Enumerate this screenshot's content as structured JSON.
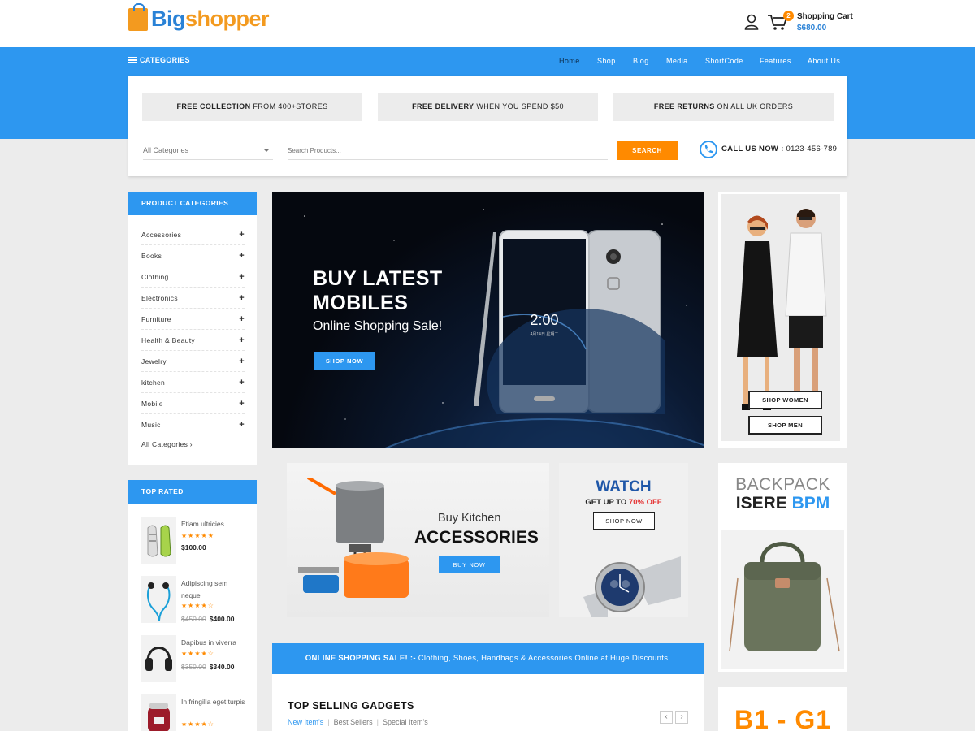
{
  "header": {
    "logo_part1": "Big",
    "logo_part2": "shopper",
    "cart_label": "Shopping Cart",
    "cart_total": "$680.00",
    "cart_count": "2"
  },
  "nav": {
    "categories_label": "CATEGORIES",
    "links": [
      "Home",
      "Shop",
      "Blog",
      "Media",
      "ShortCode",
      "Features",
      "About Us"
    ],
    "active": "Home"
  },
  "promos": [
    {
      "bold": "FREE COLLECTION",
      "rest": " FROM 400+STORES"
    },
    {
      "bold": "FREE DELIVERY",
      "rest": " WHEN YOU SPEND $50"
    },
    {
      "bold": "FREE RETURNS",
      "rest": " ON ALL UK ORDERS"
    }
  ],
  "search": {
    "category_value": "All Categories",
    "placeholder": "Search Products...",
    "button": "SEARCH",
    "call_label": "CALL US NOW :",
    "call_number": " 0123-456-789"
  },
  "product_categories": {
    "title": "PRODUCT CATEGORIES",
    "items": [
      "Accessories",
      "Books",
      "Clothing",
      "Electronics",
      "Furniture",
      "Health & Beauty",
      "Jewelry",
      "kitchen",
      "Mobile",
      "Music"
    ],
    "all_label": "All Categories ›"
  },
  "top_rated": {
    "title": "TOP RATED",
    "items": [
      {
        "name": "Etiam ultricies",
        "stars": "★★★★★",
        "old_price": "",
        "price": "$100.00"
      },
      {
        "name": "Adipiscing sem neque",
        "stars": "★★★★☆",
        "old_price": "$450.00",
        "price": "$400.00"
      },
      {
        "name": "Dapibus in viverra",
        "stars": "★★★★☆",
        "old_price": "$350.00",
        "price": "$340.00"
      },
      {
        "name": "In fringilla eget turpis",
        "stars": "★★★★☆",
        "old_price": "",
        "price": ""
      }
    ]
  },
  "hero": {
    "title_line1": "BUY LATEST",
    "title_line2": "MOBILES",
    "subtitle": "Online Shopping Sale!",
    "button": "SHOP NOW",
    "phone_time": "2:00",
    "phone_date": "4月14日 星期二"
  },
  "fashion": {
    "btn_women": "SHOP WOMEN",
    "btn_men": "SHOP MEN"
  },
  "kitchen": {
    "subtitle": "Buy Kitchen",
    "title": "ACCESSORIES",
    "button": "BUY NOW"
  },
  "watch": {
    "title": "WATCH",
    "sub_prefix": "GET UP TO ",
    "sub_highlight": "70% OFF",
    "button": "SHOP NOW"
  },
  "backpack": {
    "line1": "BACKPACK",
    "line2_a": "ISERE ",
    "line2_b": "BPM"
  },
  "sale_bar": {
    "bold": "ONLINE SHOPPING SALE! :-",
    "rest": " Clothing, Shoes, Handbags & Accessories Online at Huge Discounts."
  },
  "gadgets": {
    "title": "TOP SELLING GADGETS",
    "tabs": [
      "New Item's",
      "Best Sellers",
      "Special Item's"
    ],
    "prev": "‹",
    "next": "›"
  },
  "offer": {
    "text": "B1 - G1"
  },
  "colors": {
    "primary_blue": "#2d97f0",
    "accent_orange": "#ff8a00",
    "background": "#ececec"
  }
}
